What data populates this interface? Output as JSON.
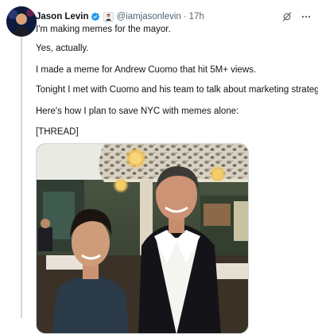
{
  "tweet": {
    "author_name": "Jason Levin",
    "handle": "@iamjasonlevin",
    "separator": "·",
    "time": "17h",
    "paragraphs": [
      "I'm making memes for the mayor.",
      "Yes, actually.",
      "I made a meme for Andrew Cuomo that hit 5M+ views.",
      "Tonight I met with Cuomo and his team to talk about marketing strategy.",
      "Here's how I plan to save NYC with memes alone:",
      "[THREAD]"
    ]
  },
  "icons": {
    "verified": "verified-badge-icon",
    "badge": "emoji-badge-icon",
    "grok": "grok-icon",
    "more": "more-options-icon"
  },
  "colors": {
    "text": "#0f1419",
    "secondary": "#536471",
    "verified": "#1d9bf0",
    "thread_line": "#cfd9de"
  }
}
